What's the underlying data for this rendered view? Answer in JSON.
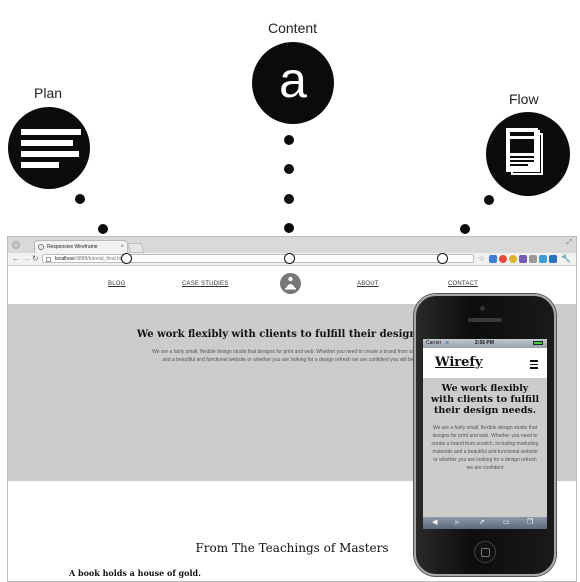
{
  "diagram": {
    "labels": {
      "plan": "Plan",
      "content": "Content",
      "flow": "Flow"
    },
    "content_glyph": "a",
    "icons": {
      "plan": "list-lines-icon",
      "content": "letter-a-icon",
      "flow": "document-icon"
    }
  },
  "browser": {
    "tab_title": "Responsive Wireframe",
    "tab_close": "×",
    "url_host": "localhost",
    "url_rest": ":8888/tutorial_final.html"
  },
  "site": {
    "nav": {
      "blog": "BLOG",
      "case_studies": "CASE STUDIES",
      "about": "ABOUT",
      "contact": "CONTACT"
    },
    "hero_title": "We work flexibly with clients to fulfill their design need",
    "hero_text_1": "We are a fairly small, flexible design studio that designs for print and web. Whether you need to create a brand from scratch, in",
    "hero_text_2": "and a beautiful and functional website or whether you are looking for a design refresh we are confident you will be ple",
    "section_title": "From The Teachings of Masters",
    "quote": "A book holds a house of gold."
  },
  "phone": {
    "carrier": "Carrier",
    "time": "2:56 PM",
    "logo": "Wirefy",
    "hero_title": "We work flexibly with clients to fulfill their design needs.",
    "hero_text": "We are a fairly small, flexible design studio that designs for print and web. Whether you need to create a brand from scratch, including marketing materials and a beautiful and functional website or whether you are looking for a design refresh we are confident"
  },
  "colors": {
    "hero_bg": "#cccccc",
    "dark": "#0b0b0b"
  }
}
